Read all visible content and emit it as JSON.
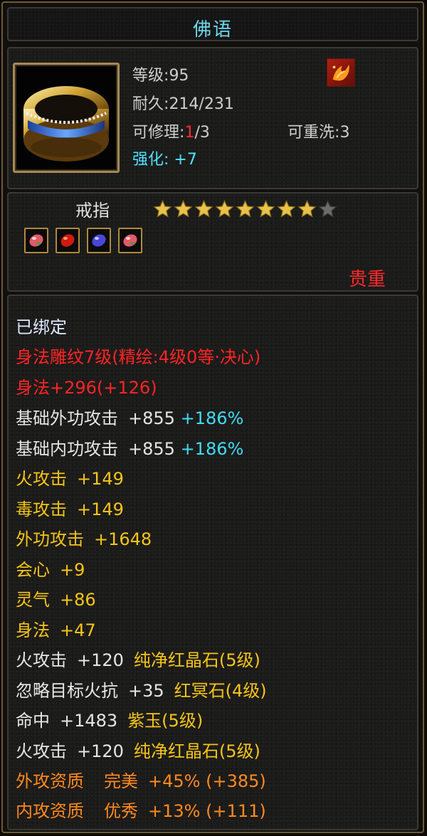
{
  "title": "佛语",
  "item": {
    "icon": "gold-ring-with-blue-band",
    "level_label": "等级",
    "level_value": "95",
    "durability_label": "耐久",
    "durability_value": "214/231",
    "repair_label": "可修理",
    "repair_current": "1",
    "repair_max": "/3",
    "rewash_label": "可重洗",
    "rewash_value": "3",
    "enhance_label": "强化",
    "enhance_value": "+7",
    "badge_icon": "phoenix-badge-icon",
    "name": "戒指",
    "stars_filled": 8,
    "stars_total": 9,
    "rarity": "贵重",
    "gems": [
      "pink-gem-icon",
      "red-gem-icon",
      "purple-gem-icon",
      "pink-gem-icon"
    ]
  },
  "stats": {
    "bound": "已绑定",
    "engrave": "身法雕纹7级(精绘:4级0等·决心)",
    "shenfa_main_label": "身法",
    "shenfa_main_value": "+296",
    "shenfa_main_bonus": "(+126)",
    "lines": [
      {
        "label": "基础外功攻击",
        "value": "+855",
        "pct": "+186%"
      },
      {
        "label": "基础内功攻击",
        "value": "+855",
        "pct": "+186%"
      }
    ],
    "yellow_lines": [
      {
        "label": "火攻击",
        "value": "+149"
      },
      {
        "label": "毒攻击",
        "value": "+149"
      },
      {
        "label": "外功攻击",
        "value": "+1648"
      },
      {
        "label": "会心",
        "value": "+9"
      },
      {
        "label": "灵气",
        "value": "+86"
      },
      {
        "label": "身法",
        "value": "+47"
      }
    ],
    "gem_lines": [
      {
        "label": "火攻击",
        "value": "+120",
        "gem": "纯净红晶石(5级)"
      },
      {
        "label": "忽略目标火抗",
        "value": "+35",
        "gem": "红冥石(4级)"
      },
      {
        "label": "命中",
        "value": "+1483",
        "gem": "紫玉(5级)"
      },
      {
        "label": "火攻击",
        "value": "+120",
        "gem": "纯净红晶石(5级)"
      }
    ],
    "quality_lines": [
      {
        "label": "外攻资质",
        "grade": "完美",
        "pct": "+45%",
        "bonus": "(+385)"
      },
      {
        "label": "内攻资质",
        "grade": "优秀",
        "pct": "+13%",
        "bonus": "(+111)"
      }
    ]
  }
}
